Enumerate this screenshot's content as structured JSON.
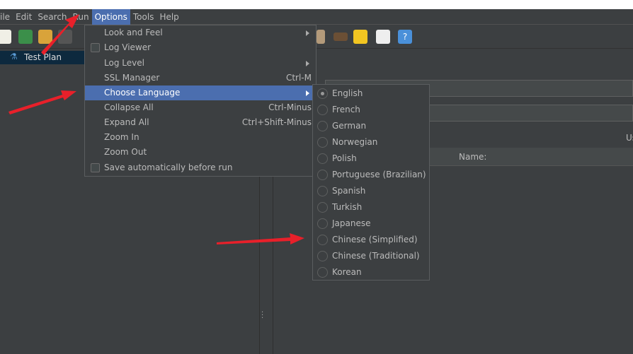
{
  "menubar": {
    "items": [
      "ile",
      "Edit",
      "Search",
      "Run",
      "Options",
      "Tools",
      "Help"
    ],
    "active": "Options"
  },
  "tree": {
    "test_plan": "Test Plan"
  },
  "right": {
    "name_label": "Name:",
    "us_label": "Us"
  },
  "options_menu": {
    "items": [
      {
        "label": "Look and Feel",
        "submenu": true
      },
      {
        "label": "Log Viewer",
        "checkbox": true
      },
      {
        "label": "Log Level",
        "submenu": true
      },
      {
        "label": "SSL Manager",
        "shortcut": "Ctrl-M"
      },
      {
        "label": "Choose Language",
        "submenu": true,
        "selected": true
      },
      {
        "label": "Collapse All",
        "shortcut": "Ctrl-Minus"
      },
      {
        "label": "Expand All",
        "shortcut": "Ctrl+Shift-Minus"
      },
      {
        "label": "Zoom In"
      },
      {
        "label": "Zoom Out"
      },
      {
        "label": "Save automatically before run",
        "checkbox": true
      }
    ]
  },
  "language_menu": {
    "selected": "English",
    "items": [
      "English",
      "French",
      "German",
      "Norwegian",
      "Polish",
      "Portuguese (Brazilian)",
      "Spanish",
      "Turkish",
      "Japanese",
      "Chinese (Simplified)",
      "Chinese (Traditional)",
      "Korean"
    ]
  },
  "colors": {
    "menu_highlight": "#4b6eaf",
    "annotation_arrow": "#e8202a",
    "background": "#3c3f41"
  }
}
